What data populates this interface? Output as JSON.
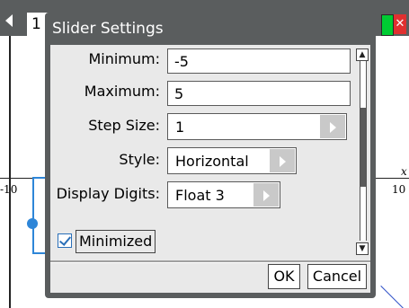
{
  "background": {
    "tab_number": "1",
    "x_axis_left_tick": "-10",
    "x_axis_right_tick": "10",
    "x_axis_name": "x"
  },
  "dialog": {
    "title": "Slider Settings",
    "fields": {
      "minimum_label": "Minimum:",
      "minimum_value": "-5",
      "maximum_label": "Maximum:",
      "maximum_value": "5",
      "step_size_label": "Step Size:",
      "step_size_value": "1",
      "style_label": "Style:",
      "style_value": "Horizontal",
      "display_digits_label": "Display Digits:",
      "display_digits_value": "Float 3"
    },
    "minimized": {
      "label": "Minimized",
      "checked": true
    },
    "buttons": {
      "ok": "OK",
      "cancel": "Cancel"
    },
    "scrollbar": {
      "up_arrow": "▲",
      "down_arrow": "▼"
    }
  },
  "colors": {
    "accent": "#2e86d8",
    "title_bar": "#5a5d5e",
    "tray_green": "#00cc33",
    "close_red": "#e03030"
  }
}
